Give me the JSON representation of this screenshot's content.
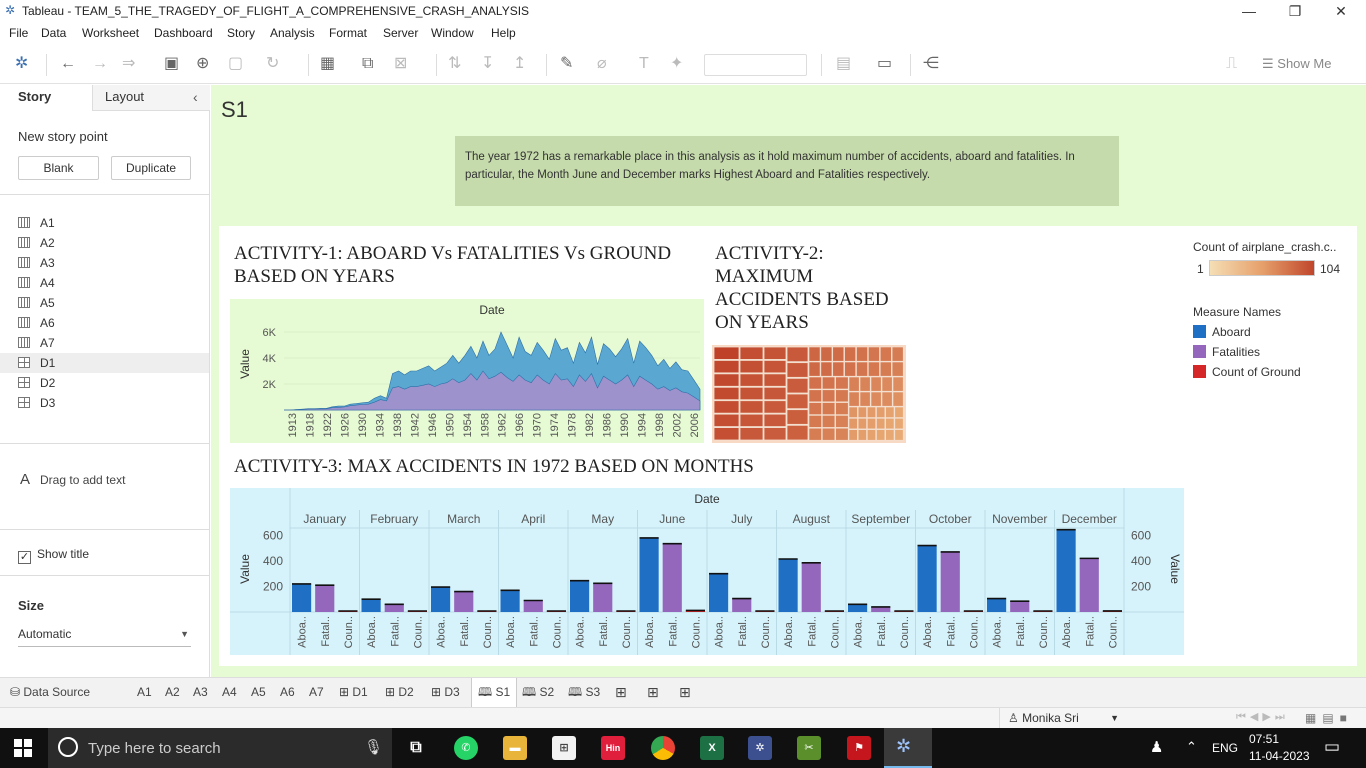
{
  "window": {
    "title": "Tableau - TEAM_5_THE_TRAGEDY_OF_FLIGHT_A_COMPREHENSIVE_CRASH_ANALYSIS",
    "min": "—",
    "max": "❐",
    "close": "✕"
  },
  "menu": [
    "File",
    "Data",
    "Worksheet",
    "Dashboard",
    "Story",
    "Analysis",
    "Format",
    "Server",
    "Window",
    "Help"
  ],
  "toolbar": {
    "show_me": "Show Me"
  },
  "left_panel": {
    "tab_story": "Story",
    "tab_layout": "Layout",
    "new_story_point": "New story point",
    "blank": "Blank",
    "duplicate": "Duplicate",
    "sheets": [
      "A1",
      "A2",
      "A3",
      "A4",
      "A5",
      "A6",
      "A7",
      "D1",
      "D2",
      "D3"
    ],
    "drag_text": "Drag to add text",
    "show_title": "Show title",
    "size_label": "Size",
    "size_value": "Automatic"
  },
  "story": {
    "title": "S1",
    "caption": "The year 1972 has a remarkable place in this analysis as it hold maximum number of accidents, aboard and fatalities. In particular, the Month June and December marks Highest Aboard and Fatalities respectively."
  },
  "activity1": {
    "title_line1": "ACTIVITY-1: ABOARD Vs FATALITIES Vs GROUND",
    "title_line2": "BASED ON YEARS",
    "header": "Date",
    "ylabel": "Value"
  },
  "activity2": {
    "title_line1": "ACTIVITY-2:",
    "title_line2": "MAXIMUM",
    "title_line3": "ACCIDENTS BASED",
    "title_line4": "ON YEARS"
  },
  "activity3": {
    "title": "ACTIVITY-3: MAX ACCIDENTS IN 1972 BASED ON MONTHS",
    "header": "Date",
    "ylabel": "Value",
    "ylabel_right": "Value"
  },
  "legend": {
    "color_title": "Count of airplane_crash.c..",
    "color_min": "1",
    "color_max": "104",
    "measure_title": "Measure Names",
    "items": [
      {
        "label": "Aboard",
        "color": "#1f6fc5"
      },
      {
        "label": "Fatalities",
        "color": "#9467bd"
      },
      {
        "label": "Count of Ground",
        "color": "#d62728"
      }
    ]
  },
  "chart_data": [
    {
      "type": "area",
      "title": "ACTIVITY-1: ABOARD Vs FATALITIES Vs GROUND BASED ON YEARS",
      "xlabel": "Date",
      "ylabel": "Value",
      "x_tick_labels": [
        "1913",
        "1918",
        "1922",
        "1926",
        "1930",
        "1934",
        "1938",
        "1942",
        "1946",
        "1950",
        "1954",
        "1958",
        "1962",
        "1966",
        "1970",
        "1974",
        "1978",
        "1982",
        "1986",
        "1990",
        "1994",
        "1998",
        "2002",
        "2006"
      ],
      "y_ticks": [
        "2K",
        "4K",
        "6K"
      ],
      "ylim": [
        0,
        7000
      ],
      "series": [
        {
          "name": "Aboard",
          "color": "#4a9fd0",
          "values": [
            0,
            0,
            30,
            60,
            100,
            100,
            120,
            120,
            250,
            300,
            300,
            450,
            500,
            550,
            600,
            900,
            1100,
            900,
            2800,
            3000,
            2700,
            3000,
            3000,
            3200,
            3400,
            3000,
            3300,
            3600,
            4200,
            3600,
            4200,
            4900,
            4000,
            5300,
            4200,
            4700,
            6000,
            5000,
            4000,
            5600,
            4500,
            4200,
            5200,
            4600,
            3900,
            5500,
            4600,
            4800,
            3600,
            5200,
            4400,
            5600,
            3500,
            5100,
            4700,
            4100,
            4700,
            5500,
            3600,
            5300,
            4800,
            4200,
            3400,
            3900,
            3200,
            3700,
            3100,
            3000,
            2300,
            1600
          ]
        },
        {
          "name": "Fatalities",
          "color": "#a58fcc",
          "values": [
            0,
            0,
            20,
            40,
            80,
            80,
            90,
            90,
            180,
            200,
            230,
            330,
            380,
            420,
            450,
            600,
            800,
            700,
            1700,
            1800,
            1600,
            1800,
            1800,
            1900,
            2000,
            1800,
            2000,
            2100,
            2400,
            2100,
            2300,
            2800,
            2300,
            3000,
            2400,
            2600,
            2900,
            2500,
            2200,
            2700,
            2300,
            2100,
            2700,
            2300,
            2000,
            2800,
            2300,
            2400,
            1800,
            2700,
            2200,
            2800,
            1700,
            2600,
            2300,
            2000,
            2300,
            2700,
            1800,
            2600,
            2300,
            2000,
            1600,
            1800,
            1500,
            1700,
            1400,
            1300,
            1000,
            700
          ]
        }
      ]
    },
    {
      "type": "heatmap",
      "title": "ACTIVITY-2: MAXIMUM ACCIDENTS BASED ON YEARS",
      "color_measure": "Count of airplane_crash.c..",
      "range": [
        1,
        104
      ]
    },
    {
      "type": "bar",
      "title": "ACTIVITY-3: MAX ACCIDENTS IN 1972 BASED ON MONTHS",
      "xlabel": "Date",
      "ylabel": "Value",
      "categories": [
        "January",
        "February",
        "March",
        "April",
        "May",
        "June",
        "July",
        "August",
        "September",
        "October",
        "November",
        "December"
      ],
      "sub_labels": [
        "Aboa..",
        "Fatal..",
        "Coun.."
      ],
      "y_ticks": [
        200,
        400,
        600
      ],
      "ylim": [
        0,
        650
      ],
      "series": [
        {
          "name": "Aboard",
          "color": "#1f6fc5",
          "values": [
            220,
            100,
            195,
            170,
            245,
            580,
            300,
            415,
            60,
            520,
            105,
            645
          ]
        },
        {
          "name": "Fatalities",
          "color": "#9467bd",
          "values": [
            210,
            60,
            160,
            90,
            225,
            535,
            105,
            385,
            40,
            470,
            85,
            420
          ]
        },
        {
          "name": "Count of Ground",
          "color": "#d62728",
          "values": [
            2,
            1,
            2,
            1,
            2,
            12,
            2,
            3,
            1,
            2,
            1,
            8
          ]
        }
      ]
    }
  ],
  "bottom_tabs": {
    "data_source": "Data Source",
    "tabs": [
      "A1",
      "A2",
      "A3",
      "A4",
      "A5",
      "A6",
      "A7",
      "D1",
      "D2",
      "D3",
      "S1",
      "S2",
      "S3"
    ]
  },
  "status": {
    "user": "Monika Sri"
  },
  "taskbar": {
    "search_placeholder": "Type here to search",
    "lang": "ENG",
    "time": "07:51",
    "date": "11-04-2023",
    "app_hin": "Hin"
  }
}
